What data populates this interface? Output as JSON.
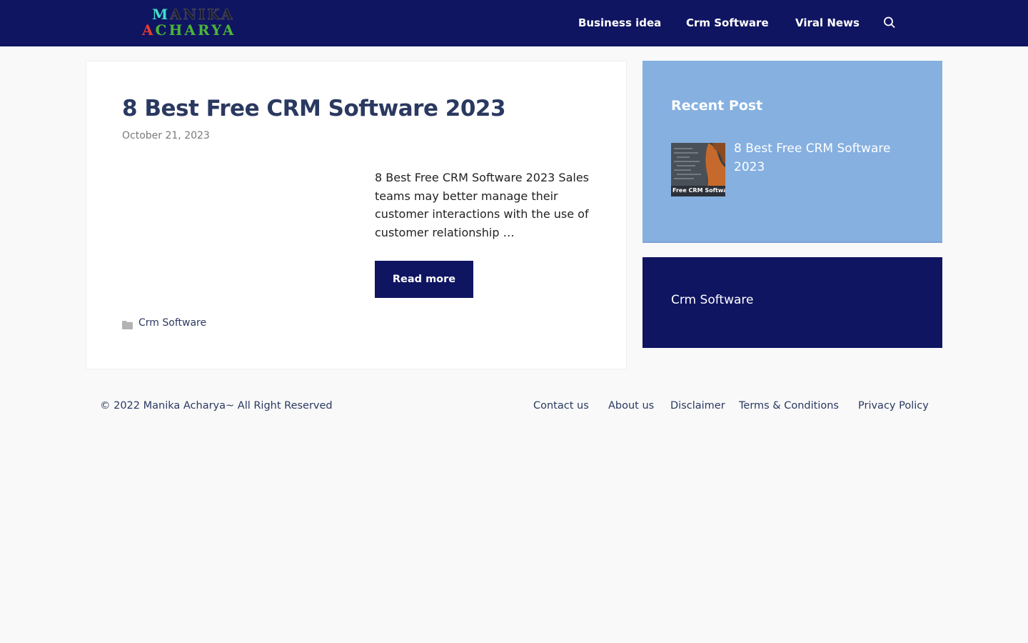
{
  "site": {
    "logo_line1_initial": "M",
    "logo_line1_rest": "ANIKA",
    "logo_line2_initial": "A",
    "logo_line2_rest": "CHARYA"
  },
  "nav": {
    "items": [
      "Business idea",
      "Crm Software",
      "Viral News"
    ],
    "search_icon": "search-icon"
  },
  "post": {
    "title": "8 Best Free CRM Software 2023",
    "date": "October 21, 2023",
    "excerpt": "8 Best Free CRM Software 2023 Sales teams may better manage their customer interactions with the use of customer relationship …",
    "read_more": "Read more",
    "category_icon": "folder-icon",
    "category": "Crm Software"
  },
  "sidebar": {
    "recent_title": "Recent Post",
    "recent_items": [
      {
        "title": "8 Best Free CRM Software 2023",
        "thumb_caption": "Free CRM Software"
      }
    ],
    "category_widget_link": "Crm Software"
  },
  "footer": {
    "copyright": "© 2022 Manika Acharya~ All Right Reserved",
    "links": [
      "Contact us",
      "About us",
      "Disclaimer",
      "Terms & Conditions",
      "Privacy Policy"
    ]
  },
  "colors": {
    "header_bg": "#0f1561",
    "accent_light_blue": "#85b0e0",
    "title_color": "#2a3960",
    "page_bg": "#f9f9f9"
  }
}
